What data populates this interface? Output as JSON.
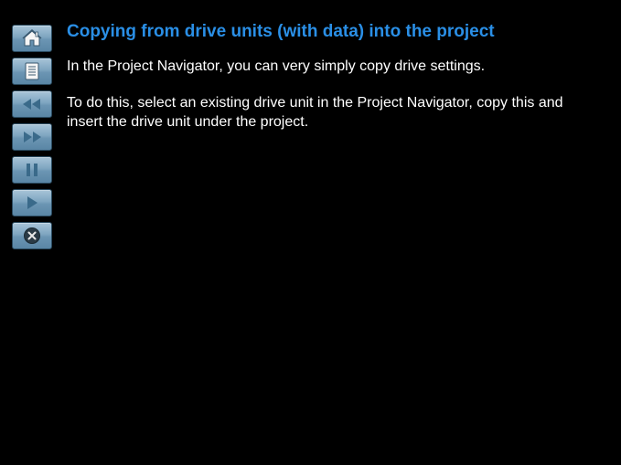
{
  "title": "Copying from drive units (with data) into the project",
  "paragraphs": [
    "In the Project Navigator, you can very simply copy drive settings.",
    "To do this, select an existing drive unit in the Project Navigator, copy this and insert the drive unit under the project."
  ],
  "toolbar": {
    "home": "home-icon",
    "contents": "document-icon",
    "back": "rewind-icon",
    "forward": "fast-forward-icon",
    "pause": "pause-icon",
    "play": "play-icon",
    "close": "close-icon"
  }
}
